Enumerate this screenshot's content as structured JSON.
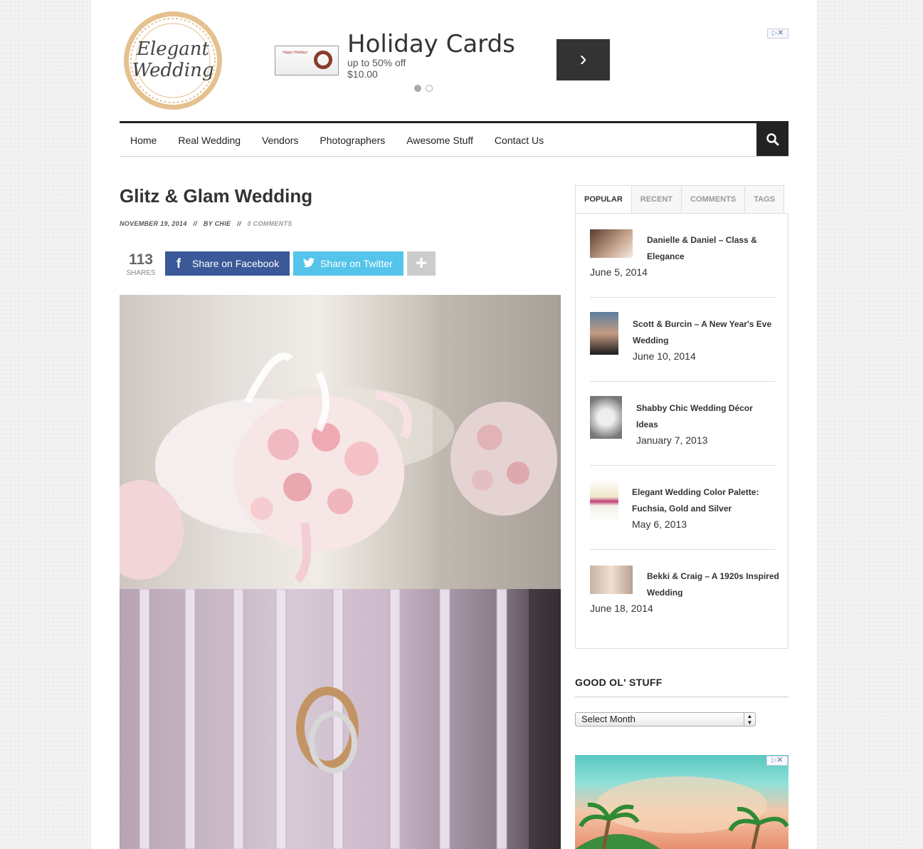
{
  "logo": {
    "line1": "Elegant",
    "line2": "Wedding"
  },
  "header_ad": {
    "thumb_text": "Happy Holidays",
    "title": "Holiday Cards",
    "subtitle": "up to 50% off",
    "price": "$10.00",
    "next_glyph": "›",
    "adchoices": "▷"
  },
  "nav": {
    "items": [
      "Home",
      "Real Wedding",
      "Vendors",
      "Photographers",
      "Awesome Stuff",
      "Contact Us"
    ]
  },
  "post": {
    "title": "Glitz & Glam Wedding",
    "date": "November 19, 2014",
    "author": "By Chie",
    "comments": "0 Comments",
    "separator": "//"
  },
  "share": {
    "count": "113",
    "count_label": "SHARES",
    "facebook_icon": "f",
    "facebook_label": "Share on Facebook",
    "twitter_label": "Share on Twitter",
    "more_label": "+"
  },
  "sidebar": {
    "tabs": [
      "POPULAR",
      "RECENT",
      "COMMENTS",
      "TAGS"
    ],
    "popular": [
      {
        "title": "Danielle & Daniel – Class & Elegance",
        "date": "June 5, 2014"
      },
      {
        "title": "Scott & Burcin – A New Year's Eve Wedding",
        "date": "June 10, 2014"
      },
      {
        "title": "Shabby Chic Wedding Décor Ideas",
        "date": "January 7, 2013"
      },
      {
        "title": "Elegant Wedding Color Palette: Fuchsia, Gold and Silver",
        "date": "May 6, 2013"
      },
      {
        "title": "Bekki & Craig – A 1920s Inspired Wedding",
        "date": "June 18, 2014"
      }
    ],
    "archive_title": "GOOD OL' STUFF",
    "archive_select": "Select Month"
  },
  "colors": {
    "facebook": "#3b5998",
    "twitter": "#55c4ea",
    "nav_border": "#222222",
    "logo_gold": "#e4c18f"
  }
}
